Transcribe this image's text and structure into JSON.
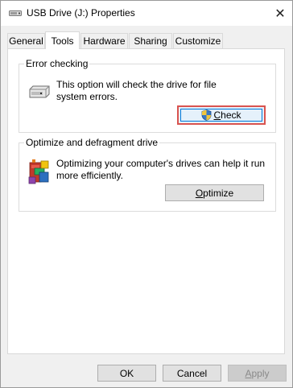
{
  "window": {
    "title": "USB Drive (J:) Properties",
    "close_glyph": "✕"
  },
  "tabs": [
    {
      "label": "General"
    },
    {
      "label": "Tools",
      "active": true
    },
    {
      "label": "Hardware"
    },
    {
      "label": "Sharing"
    },
    {
      "label": "Customize"
    }
  ],
  "error_checking": {
    "title": "Error checking",
    "description": "This option will check the drive for file system errors.",
    "button_label_accel": "C",
    "button_label_rest": "heck",
    "icon": "usb-drive-icon"
  },
  "optimize": {
    "title": "Optimize and defragment drive",
    "description": "Optimizing your computer's drives can help it run more efficiently.",
    "button_label_accel": "O",
    "button_label_rest": "ptimize",
    "icon": "defragment-icon"
  },
  "footer": {
    "ok_label": "OK",
    "cancel_label": "Cancel",
    "apply_label_accel": "A",
    "apply_label_rest": "pply"
  },
  "colors": {
    "highlight_border": "#d9534f",
    "focus_border": "#0078d7",
    "button_bg": "#e1e1e1",
    "disabled_text": "#8a8a8a"
  }
}
